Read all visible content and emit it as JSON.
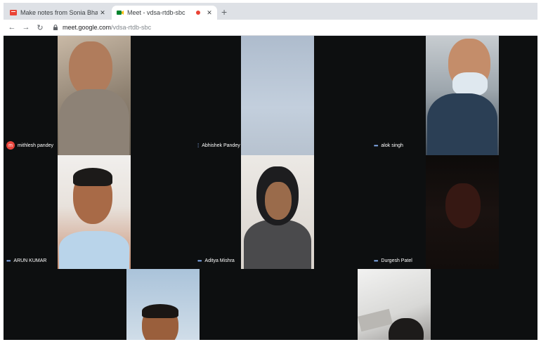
{
  "browser": {
    "tabs": [
      {
        "title": "Make notes from Sonia Bhatt ...",
        "active": false
      },
      {
        "title": "Meet - vdsa-rtdb-sbc",
        "active": true
      }
    ],
    "url_host": "meet.google.com",
    "url_path": "/vdsa-rtdb-sbc"
  },
  "participants": [
    {
      "name": "mithlesh pandey",
      "avatar_letter": "m"
    },
    {
      "name": "Abhishek Pandey"
    },
    {
      "name": "alok singh"
    },
    {
      "name": "ARUN KUMAR"
    },
    {
      "name": "Aditya Mishra"
    },
    {
      "name": "Durgesh Patel"
    }
  ],
  "colors": {
    "meet_background": "#0d0f10",
    "speaking_indicator": "#8ab4f8",
    "avatar_red": "#e8453c"
  }
}
